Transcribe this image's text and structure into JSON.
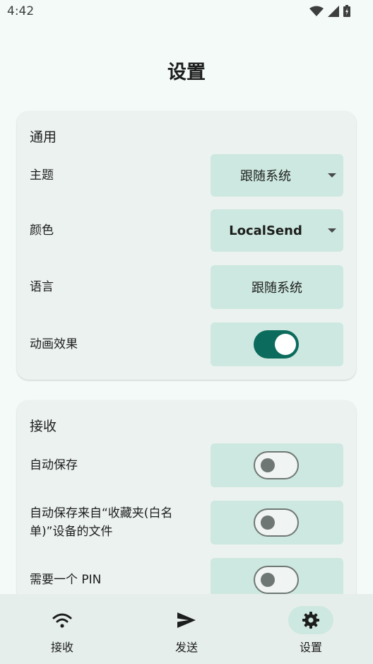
{
  "status_bar": {
    "time": "4:42",
    "icons": [
      "wifi-icon",
      "signal-icon",
      "battery-icon"
    ]
  },
  "page": {
    "title": "设置"
  },
  "general": {
    "title": "通用",
    "theme": {
      "label": "主题",
      "value": "跟随系统"
    },
    "color": {
      "label": "颜色",
      "value": "LocalSend"
    },
    "language": {
      "label": "语言",
      "value": "跟随系统"
    },
    "animations": {
      "label": "动画效果",
      "enabled": true
    }
  },
  "receive": {
    "title": "接收",
    "auto_save": {
      "label": "自动保存",
      "enabled": false
    },
    "auto_save_favorites": {
      "label": "自动保存来自“收藏夹(白名单)”设备的文件",
      "enabled": false
    },
    "require_pin": {
      "label": "需要一个 PIN",
      "enabled": false
    }
  },
  "bottom_nav": {
    "items": [
      {
        "label": "接收",
        "icon": "wifi-icon",
        "active": false
      },
      {
        "label": "发送",
        "icon": "send-icon",
        "active": false
      },
      {
        "label": "设置",
        "icon": "gear-icon",
        "active": true
      }
    ]
  },
  "colors": {
    "background": "#f4faf7",
    "card": "#ecf2ef",
    "control": "#cde8e0",
    "accent": "#0b6b5c"
  }
}
